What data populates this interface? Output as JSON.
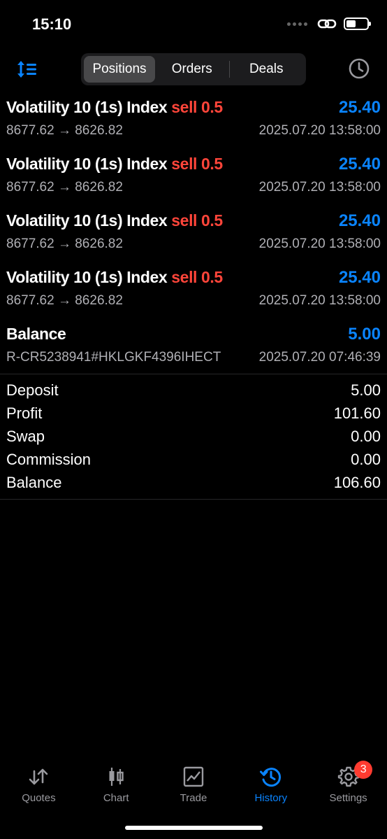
{
  "status_bar": {
    "time": "15:10"
  },
  "toolbar": {
    "tabs": [
      "Positions",
      "Orders",
      "Deals"
    ],
    "active_tab": "Positions",
    "sort_icon": "sort-icon",
    "history_icon": "clock-icon"
  },
  "deals": [
    {
      "symbol": "Volatility 10 (1s) Index",
      "side": "sell 0.5",
      "profit": "25.40",
      "prices": "8677.62 → 8626.82",
      "datetime": "2025.07.20 13:58:00"
    },
    {
      "symbol": "Volatility 10 (1s) Index",
      "side": "sell 0.5",
      "profit": "25.40",
      "prices": "8677.62 → 8626.82",
      "datetime": "2025.07.20 13:58:00"
    },
    {
      "symbol": "Volatility 10 (1s) Index",
      "side": "sell 0.5",
      "profit": "25.40",
      "prices": "8677.62 → 8626.82",
      "datetime": "2025.07.20 13:58:00"
    },
    {
      "symbol": "Volatility 10 (1s) Index",
      "side": "sell 0.5",
      "profit": "25.40",
      "prices": "8677.62 → 8626.82",
      "datetime": "2025.07.20 13:58:00"
    },
    {
      "symbol": "Balance",
      "side": "",
      "profit": "5.00",
      "prices": "R-CR5238941#HKLGKF4396IHECT",
      "datetime": "2025.07.20 07:46:39"
    }
  ],
  "summary": [
    {
      "label": "Deposit",
      "value": "5.00"
    },
    {
      "label": "Profit",
      "value": "101.60"
    },
    {
      "label": "Swap",
      "value": "0.00"
    },
    {
      "label": "Commission",
      "value": "0.00"
    },
    {
      "label": "Balance",
      "value": "106.60"
    }
  ],
  "tabbar": {
    "items": [
      {
        "label": "Quotes",
        "icon": "quotes-icon"
      },
      {
        "label": "Chart",
        "icon": "chart-icon"
      },
      {
        "label": "Trade",
        "icon": "trade-icon"
      },
      {
        "label": "History",
        "icon": "history-icon"
      },
      {
        "label": "Settings",
        "icon": "settings-icon"
      }
    ],
    "active": "History",
    "settings_badge": "3"
  },
  "colors": {
    "accent": "#0a84ff",
    "sell": "#ff453a",
    "badge": "#ff3b30"
  }
}
